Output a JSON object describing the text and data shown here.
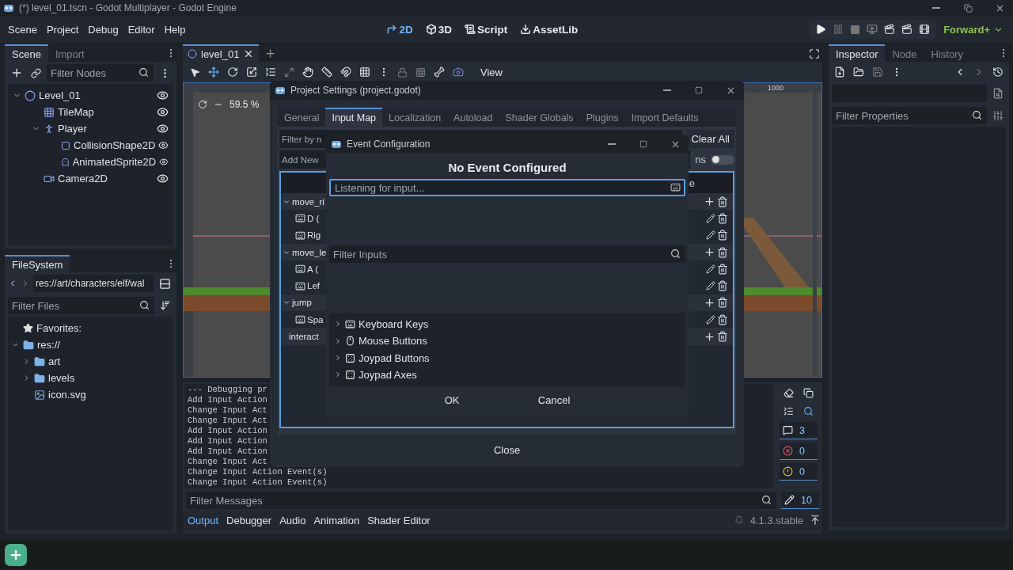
{
  "title_bar": {
    "title": "(*) level_01.tscn - Godot Multiplayer - Godot Engine"
  },
  "menu": [
    "Scene",
    "Project",
    "Debug",
    "Editor",
    "Help"
  ],
  "workspaces": [
    {
      "label": "2D",
      "kind": "planar",
      "selected": true
    },
    {
      "label": "3D",
      "kind": "spatial",
      "selected": false
    },
    {
      "label": "Script",
      "kind": "script",
      "selected": false
    },
    {
      "label": "AssetLib",
      "kind": "assetlib",
      "selected": false
    }
  ],
  "run_bar": {
    "renderer": "Forward+"
  },
  "scene_dock": {
    "tabs": [
      {
        "label": "Scene",
        "selected": true
      },
      {
        "label": "Import",
        "selected": false
      }
    ],
    "filter": {
      "placeholder": "Filter Nodes"
    },
    "tree": [
      {
        "label": "Level_01",
        "kind": "root",
        "children": [
          {
            "label": "TileMap",
            "kind": "tilemap"
          },
          {
            "label": "Player",
            "kind": "character",
            "children": [
              {
                "label": "CollisionShape2D",
                "kind": "shape"
              },
              {
                "label": "AnimatedSprite2D",
                "kind": "sprite"
              }
            ]
          },
          {
            "label": "Camera2D",
            "kind": "camera"
          }
        ]
      }
    ]
  },
  "filesystem": {
    "tab": "FileSystem",
    "path": "res://art/characters/elf/wal",
    "filter": {
      "placeholder": "Filter Files"
    },
    "tree": [
      {
        "label": "Favorites:",
        "kind": "favorites"
      },
      {
        "label": "res://",
        "kind": "folder",
        "expanded": true,
        "children": [
          {
            "label": "art",
            "kind": "folder",
            "expanded": false
          },
          {
            "label": "levels",
            "kind": "folder",
            "expanded": false
          },
          {
            "label": "icon.svg",
            "kind": "file"
          }
        ]
      }
    ]
  },
  "editor_tabs": [
    {
      "label": "level_01",
      "selected": true
    }
  ],
  "viewport": {
    "toolbar_button": "View",
    "zoom": "59.5 %",
    "ruler_mark": "1000"
  },
  "project_settings": {
    "title": "Project Settings (project.godot)",
    "tabs": [
      {
        "label": "General",
        "selected": false
      },
      {
        "label": "Input Map",
        "selected": true
      },
      {
        "label": "Localization",
        "selected": false
      },
      {
        "label": "Autoload",
        "selected": false
      },
      {
        "label": "Shader Globals",
        "selected": false
      },
      {
        "label": "Plugins",
        "selected": false
      },
      {
        "label": "Import Defaults",
        "selected": false
      }
    ],
    "filter_text": "Filter by n",
    "clear_button": "Clear All",
    "add_text": "Add New",
    "toggle_label": "ns",
    "toggle_on": false,
    "header_fragment": "e",
    "actions": [
      {
        "name": "move_ri",
        "expanded": true,
        "events": [
          "D (",
          "Rig"
        ]
      },
      {
        "name": "move_le",
        "expanded": true,
        "events": [
          "A (",
          "Lef"
        ]
      },
      {
        "name": "jump",
        "expanded": true,
        "events": [
          "Spa"
        ]
      },
      {
        "name": "interact"
      }
    ],
    "close_button": "Close"
  },
  "event_dialog": {
    "title": "Event Configuration",
    "heading": "No Event Configured",
    "listen": {
      "placeholder": "Listening for input..."
    },
    "filter": {
      "placeholder": "Filter Inputs"
    },
    "categories": [
      {
        "label": "Keyboard Keys",
        "kind": "keyboard"
      },
      {
        "label": "Mouse Buttons",
        "kind": "mouse"
      },
      {
        "label": "Joypad Buttons",
        "kind": "joypad"
      },
      {
        "label": "Joypad Axes",
        "kind": "axes"
      }
    ],
    "buttons": [
      "OK",
      "Cancel"
    ]
  },
  "output": {
    "lines": [
      "--- Debugging pr",
      "Add Input Action",
      "Change Input Act",
      "Change Input Act",
      "Add Input Action",
      "Add Input Action",
      "Add Input Action",
      "Change Input Act",
      "Change Input Action Event(s)",
      "Change Input Action Event(s)"
    ],
    "filter": {
      "placeholder": "Filter Messages"
    },
    "counters": [
      {
        "kind": "message",
        "count": "3"
      },
      {
        "kind": "error",
        "count": "0"
      },
      {
        "kind": "warning",
        "count": "0"
      },
      {
        "kind": "info",
        "count": "10"
      }
    ]
  },
  "bottom_tabs": [
    {
      "label": "Output",
      "selected": true
    },
    {
      "label": "Debugger",
      "selected": false
    },
    {
      "label": "Audio",
      "selected": false
    },
    {
      "label": "Animation",
      "selected": false
    },
    {
      "label": "Shader Editor",
      "selected": false
    }
  ],
  "version": "4.1.3.stable",
  "inspector": {
    "tabs": [
      {
        "label": "Inspector",
        "selected": true
      },
      {
        "label": "Node",
        "selected": false
      },
      {
        "label": "History",
        "selected": false
      }
    ],
    "filter": {
      "placeholder": "Filter Properties"
    }
  }
}
